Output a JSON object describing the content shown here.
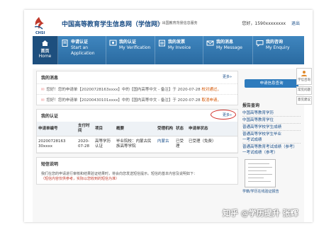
{
  "header": {
    "logo_text": "CHSI",
    "site_title": "中国高等教育学生信息网（学信网）",
    "site_subtitle": "— 出国教育背景信息服务",
    "user_phone": "您好，1590xxxxxxxx",
    "logout": "退出"
  },
  "nav": {
    "items": [
      {
        "zh": "首页",
        "en": "Home"
      },
      {
        "zh": "申请认证",
        "en": "Start an Application"
      },
      {
        "zh": "我的认证",
        "en": "My Verification"
      },
      {
        "zh": "我的发票",
        "en": "My Invoice"
      },
      {
        "zh": "我的消息",
        "en": "My Message"
      },
      {
        "zh": "我的咨询",
        "en": "My Enquiry"
      }
    ]
  },
  "messages": {
    "title": "我的消息",
    "more": "更多»",
    "rows": [
      {
        "text": "您好！您的申请单【20200728163xxxx】中的【国内高等中文 - 备注】于 2020-07-28",
        "action": "校对通过，"
      },
      {
        "text": "您好！您的申请单【20200430101xxxx】中的【国内高等中文 - 备注】于 2020-07-28",
        "action": "取消申请，"
      }
    ]
  },
  "certs": {
    "title": "我的认证",
    "more": "更多»",
    "headers": [
      "申请单编号",
      "支付时间",
      "项目",
      "概要",
      "受理机构",
      "状态",
      "申请单状态"
    ],
    "rows": [
      {
        "id": "20200728163 30xxxx",
        "pay_time": "2020-07-28",
        "project": "高等学历认证",
        "summary": "毕业院校：内蒙古民族高等学院",
        "agency": "内蒙古",
        "status": "已受理",
        "order_status": "已受理（免费）"
      }
    ]
  },
  "sms": {
    "title": "短信说明",
    "text": "我们在您的申请进行审核和结果验证结果时，将会向您发送短信提示。短信的基本内容及说明如下：",
    "warn": "（短信内容仅供参考，实际以您收到的短信为准）"
  },
  "sidebar": {
    "apply_button": "申请信息查询",
    "report_title": "报告查询",
    "links": [
      "中国高等教育学历",
      "中国高等教育学位",
      "普通高等学校学生成绩",
      "普通高等学校学生毕业",
      "一考试成绩",
      "普通高等教育考试成绩（参考）",
      "一考试成绩（参考）"
    ],
    "doc_caption": "学籍/学历在线验证报告"
  },
  "floatbar": {
    "items": [
      "学信咨询",
      "常见问题",
      "意见建议"
    ]
  },
  "watermark": "知乎 @学历提升 张辉",
  "colors": {
    "nav_bg": "#2e74ad",
    "nav_active": "#1d4f7e",
    "brand": "#1b4e86",
    "highlight_circle": "#d2302a",
    "accent_orange": "#d35400"
  }
}
